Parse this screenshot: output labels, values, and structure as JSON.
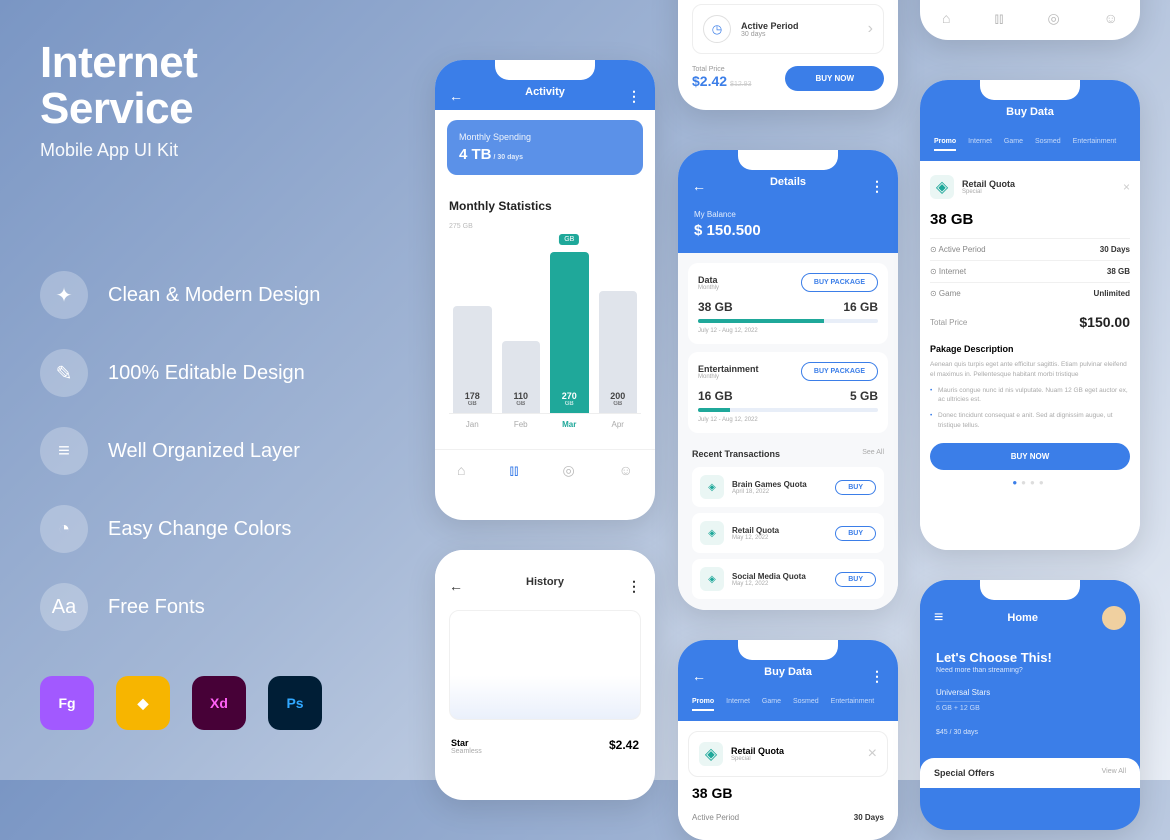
{
  "hero": {
    "title1": "Internet",
    "title2": "Service",
    "subtitle": "Mobile App UI Kit"
  },
  "features": [
    {
      "icon": "✦",
      "text": "Clean & Modern Design"
    },
    {
      "icon": "✎",
      "text": "100% Editable Design"
    },
    {
      "icon": "≡",
      "text": "Well Organized Layer"
    },
    {
      "icon": "◔",
      "text": "Easy Change Colors"
    },
    {
      "icon": "Aa",
      "text": "Free Fonts"
    }
  ],
  "tools": [
    "Fg",
    "◆",
    "Xd",
    "Ps"
  ],
  "tool_colors": [
    "#a259ff",
    "#f7b500",
    "#470137",
    "#001e36"
  ],
  "tool_text_colors": [
    "#fff",
    "#fff",
    "#ff61f6",
    "#31a8ff"
  ],
  "p1": {
    "title": "Activity",
    "spending_label": "Monthly Spending",
    "spending_value": "4 TB",
    "spending_sub": " / 30 days",
    "stats_title": "Monthly Statistics",
    "y_marker": "275 GB",
    "badge": "GB",
    "bars": [
      {
        "h": 60,
        "val": "178",
        "sub": "GB",
        "month": "Jan"
      },
      {
        "h": 40,
        "val": "110",
        "sub": "GB",
        "month": "Feb"
      },
      {
        "h": 90,
        "val": "270",
        "sub": "GB",
        "month": "Mar",
        "active": true
      },
      {
        "h": 68,
        "val": "200",
        "sub": "GB",
        "month": "Apr"
      }
    ]
  },
  "p2t": {
    "card_title": "Active Period",
    "card_sub": "30 days",
    "price_label": "Total Price",
    "price": "$2.42",
    "price_old": "$12.93",
    "buy": "BUY NOW"
  },
  "p3": {
    "title": "Details",
    "balance_label": "My Balance",
    "balance": "$ 150.500",
    "cards": [
      {
        "name": "Data",
        "sub": "Monthly",
        "btn": "BUY PACKAGE",
        "left": "38 GB",
        "right": "16 GB",
        "prog": 70,
        "date": "July 12 - Aug 12, 2022"
      },
      {
        "name": "Entertainment",
        "sub": "Monthly",
        "btn": "BUY PACKAGE",
        "left": "16 GB",
        "right": "5 GB",
        "prog": 18,
        "date": "July 12 - Aug 12, 2022"
      }
    ],
    "recent_title": "Recent Transactions",
    "see_all": "See All",
    "trans": [
      {
        "name": "Brain Games Quota",
        "date": "April 18, 2022",
        "btn": "BUY"
      },
      {
        "name": "Retail Quota",
        "date": "May 12, 2022",
        "btn": "BUY"
      },
      {
        "name": "Social Media Quota",
        "date": "May 12, 2022",
        "btn": "BUY"
      }
    ]
  },
  "p4t": {
    "months": [
      "Jan",
      "Feb",
      "Mar",
      "Apr"
    ],
    "active": 2
  },
  "p5": {
    "title": "Buy Data",
    "tabs": [
      "Promo",
      "Internet",
      "Game",
      "Sosmed",
      "Entertainment"
    ],
    "rq_title": "Retail Quota",
    "rq_sub": "Special",
    "size": "38 GB",
    "rows": [
      {
        "l": "Active Period",
        "v": "30 Days"
      },
      {
        "l": "Internet",
        "v": "38 GB"
      },
      {
        "l": "Game",
        "v": "Unlimited"
      }
    ],
    "tp_label": "Total Price",
    "tp_value": "$150.00",
    "desc_title": "Pakage Description",
    "desc": "Aenean quis turpis eget ante efficitur sagittis. Etiam pulvinar eleifend el maximus in. Pellentesque habitant morbi tristique",
    "bullets": [
      "Mauris congue nunc id nis vulputate. Nuam 12 GB eget auctor ex, ac ultricies est.",
      "Donec tincidunt consequat e anit. Sed at dignissim augue, ut tristique tellus."
    ],
    "buy": "BUY NOW"
  },
  "p6": {
    "title": "History",
    "name": "Star",
    "sub": "Seamless",
    "price": "$2.42"
  },
  "p7": {
    "title": "Buy Data",
    "tabs": [
      "Promo",
      "Internet",
      "Game",
      "Sosmed",
      "Entertainment"
    ],
    "rq_title": "Retail Quota",
    "rq_sub": "Special",
    "size": "38 GB",
    "row_l": "Active Period",
    "row_v": "30 Days"
  },
  "p8": {
    "title": "Home",
    "hero_t": "Let's Choose This!",
    "hero_s": "Need more than streaming?",
    "us_name": "Universal Stars",
    "us_gb": "6 GB + 12 GB",
    "us_price": "$45",
    "us_sub": " / 30 days",
    "so_title": "Special Offers",
    "so_link": "View All"
  },
  "chart_data": {
    "type": "bar",
    "title": "Monthly Statistics",
    "categories": [
      "Jan",
      "Feb",
      "Mar",
      "Apr"
    ],
    "values": [
      178,
      110,
      270,
      200
    ],
    "unit": "GB",
    "ylim": [
      0,
      300
    ],
    "highlight_index": 2,
    "y_reference_line": 275
  }
}
